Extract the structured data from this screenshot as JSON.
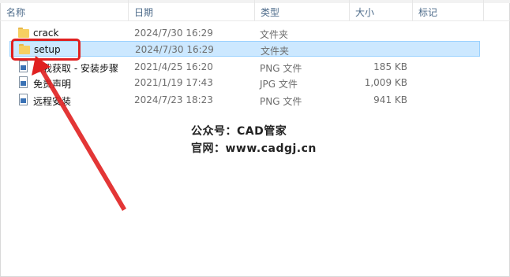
{
  "columns": {
    "name": "名称",
    "date": "日期",
    "type": "类型",
    "size": "大小",
    "tags": "标记"
  },
  "files": [
    {
      "name": "crack",
      "date": "2024/7/30 16:29",
      "type": "文件夹",
      "size": "",
      "icon": "folder-icon"
    },
    {
      "name": "setup",
      "date": "2024/7/30 16:29",
      "type": "文件夹",
      "size": "",
      "icon": "folder-icon",
      "selected": true
    },
    {
      "name": "点我获取 - 安装步骤",
      "date": "2021/4/25 16:20",
      "type": "PNG 文件",
      "size": "185 KB",
      "icon": "image-file-icon"
    },
    {
      "name": "免责声明",
      "date": "2021/1/19 17:43",
      "type": "JPG 文件",
      "size": "1,009 KB",
      "icon": "image-file-icon"
    },
    {
      "name": "远程安装",
      "date": "2024/7/23 18:23",
      "type": "PNG 文件",
      "size": "941 KB",
      "icon": "image-file-icon"
    }
  ],
  "watermark": {
    "line1": "公众号：CAD管家",
    "line2": "官网：www.cadgj.cn"
  },
  "annotation_color": "#e02020",
  "selection_color": "#cce8ff"
}
